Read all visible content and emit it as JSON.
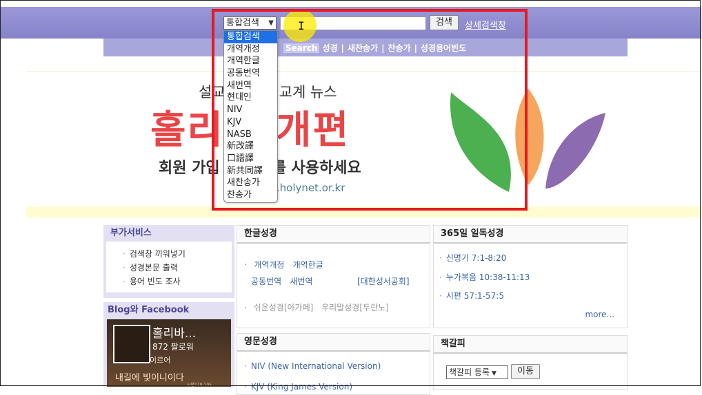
{
  "search": {
    "select_value": "통합검색",
    "button_label": "검색",
    "advanced_link": "상세검색창",
    "dropdown_options": [
      "통합검색",
      "개역개정",
      "개역한글",
      "공동번역",
      "새번역",
      "현대인",
      "NIV",
      "KJV",
      "NASB",
      "新改譯",
      "口語譯",
      "新共同譯",
      "새찬송가",
      "찬송가"
    ],
    "selected_index": 0
  },
  "subnav": {
    "search_tag": "Search",
    "items": [
      "성경",
      "새찬송가",
      "찬송가",
      "성경용어빈도"
    ],
    "separator": "|"
  },
  "banner": {
    "subtitle": "설교 빙정보, 교계 뉴스",
    "title": "홀리 총개편",
    "member_text": "회원 가입 든 자료를 사용하세요",
    "url": "w.holynet.or.kr"
  },
  "left": {
    "services_title": "부가서비스",
    "services": [
      "검색창 끼워넣기",
      "성경본문 출력",
      "용어 빈도 조사"
    ],
    "blog_title": "Blog와 Facebook",
    "fb_name": "홀리바...",
    "fb_followers": "872 팔로워",
    "fb_text1": "이르어",
    "fb_text2": "내길에 빛이니이다",
    "fb_text3": "시편119:105"
  },
  "korean_bible": {
    "title": "한글성경",
    "row1": [
      "개역개정",
      "개역한글"
    ],
    "row2": [
      "공동번역",
      "새번역"
    ],
    "society": "[대한성서공회]",
    "row3": [
      "쉬운성경[아가페]",
      "우리말성경[두란노]"
    ]
  },
  "english_bible": {
    "title": "영문성경",
    "niv": "NIV (New International Version)",
    "kjv": "KJV (King James Version)"
  },
  "daily": {
    "title": "365일 일독성경",
    "readings": [
      "신명기 7:1-8:20",
      "누가복음 10:38-11:13",
      "시편 57:1-57:5"
    ],
    "more": "more..."
  },
  "bookmark": {
    "title": "책갈피",
    "select_value": "책갈피 등록",
    "button_label": "이동"
  },
  "colors": {
    "topbar": "#8683c8",
    "highlight_box": "#e8191e",
    "selected_option": "#1e70e6",
    "banner_title": "#e94547"
  }
}
